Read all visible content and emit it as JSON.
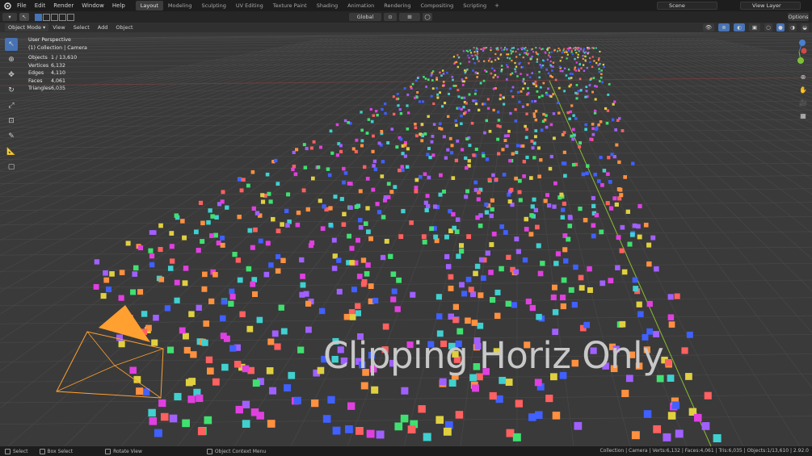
{
  "menubar": {
    "items": [
      "File",
      "Edit",
      "Render",
      "Window",
      "Help"
    ]
  },
  "workspaces": [
    "Layout",
    "Modeling",
    "Sculpting",
    "UV Editing",
    "Texture Paint",
    "Shading",
    "Animation",
    "Rendering",
    "Compositing",
    "Scripting"
  ],
  "workspace_add": "+",
  "scene": {
    "label": "Scene"
  },
  "view_layer": {
    "label": "View Layer"
  },
  "header": {
    "transform_orientation": "Global",
    "options": "Options"
  },
  "viewport_header": {
    "mode": "Object Mode",
    "menus": [
      "View",
      "Select",
      "Add",
      "Object"
    ]
  },
  "overlay": {
    "perspective": "User Perspective",
    "collection": "(1) Collection | Camera",
    "stats": [
      {
        "key": "Objects",
        "value": "1 / 13,610"
      },
      {
        "key": "Vertices",
        "value": "6,132"
      },
      {
        "key": "Edges",
        "value": "4,110"
      },
      {
        "key": "Faces",
        "value": "4,061"
      },
      {
        "key": "Triangles",
        "value": "6,035"
      }
    ]
  },
  "caption": "Clipping Horiz Only",
  "statusbar": {
    "select": "Select",
    "box_select": "Box Select",
    "rotate_view": "Rotate View",
    "context_menu": "Object Context Menu",
    "info": "Collection | Camera | Verts:6,132 | Faces:4,061 | Tris:6,035 | Objects:1/13,610 | 2.92.0"
  },
  "colors": {
    "accent": "#4772b3",
    "camera": "#ffa030",
    "axis_y": "#8bbd30",
    "cube_palette": [
      "#e040e0",
      "#40d0d0",
      "#e0d040",
      "#40e070",
      "#ff6060",
      "#4060ff",
      "#a060ff",
      "#ff9040"
    ]
  }
}
